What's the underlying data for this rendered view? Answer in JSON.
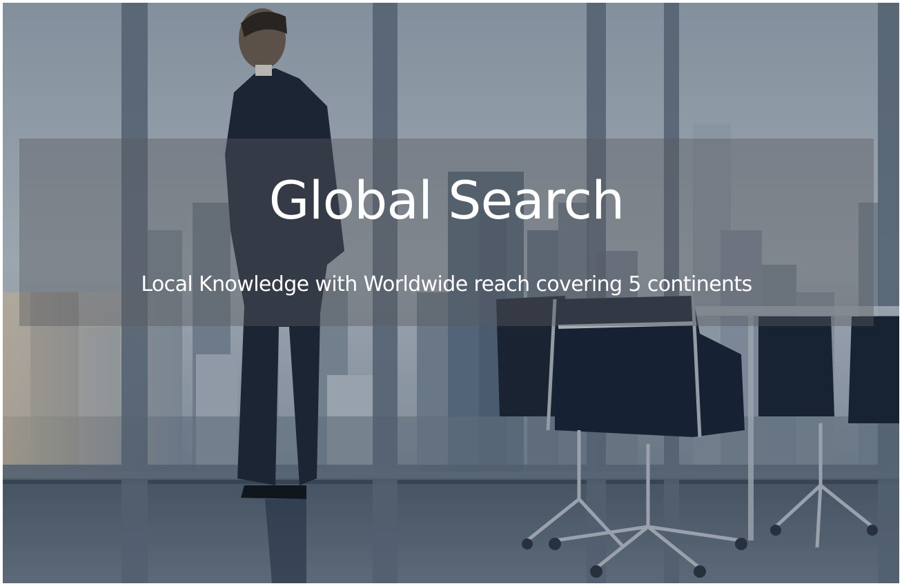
{
  "hero": {
    "title": "Global Search",
    "subtitle": "Local Knowledge with Worldwide reach covering 5 continents",
    "background_image": "businessman in suit looking out office window at city skyline, conference room chairs in foreground"
  },
  "colors": {
    "text": "#ffffff",
    "banner_overlay": "#5a5a5f",
    "sky": "#b9c2cc",
    "window_frame": "#5e6b7c",
    "suit": "#1c2434"
  }
}
